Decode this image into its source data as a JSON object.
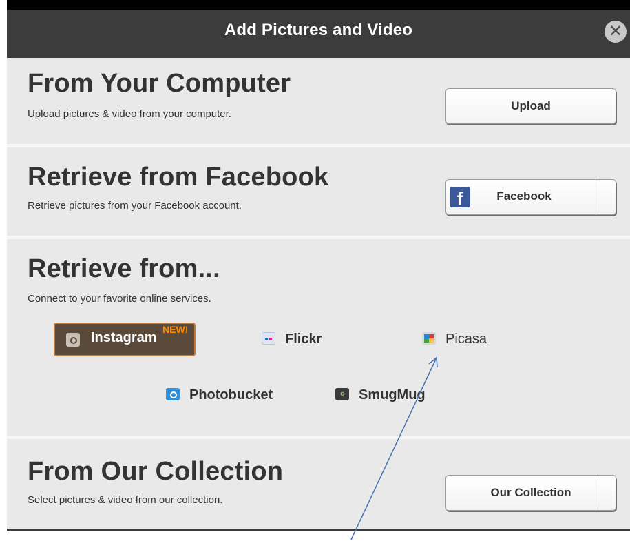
{
  "dialog": {
    "title": "Add Pictures and Video",
    "close_icon": "close-icon"
  },
  "sections": {
    "computer": {
      "heading": "From Your Computer",
      "description": "Upload pictures & video from your computer.",
      "button_label": "Upload"
    },
    "facebook": {
      "heading": "Retrieve from Facebook",
      "description": "Retrieve pictures from your Facebook account.",
      "button_label": "Facebook",
      "logo_letter": "f"
    },
    "services": {
      "heading": "Retrieve from...",
      "description": "Connect to your favorite online services.",
      "instagram": {
        "label": "Instagram",
        "badge": "NEW!"
      },
      "flickr": {
        "label": "Flickr"
      },
      "picasa": {
        "label": "Picasa"
      },
      "photobucket": {
        "label": "Photobucket"
      },
      "smugmug": {
        "label": "SmugMug",
        "icon_glyph": "ͨ"
      }
    },
    "collection": {
      "heading": "From Our Collection",
      "description": "Select pictures & video from our collection.",
      "button_label": "Our Collection"
    }
  },
  "colors": {
    "title_bar": "#3c3c3c",
    "panel": "#e9e9ea",
    "instagram_bg": "#5a4a3c",
    "instagram_border": "#c27a3c",
    "new_badge": "#ff8a00",
    "facebook_blue": "#3b5998",
    "annotation_arrow": "#4a72b0"
  }
}
